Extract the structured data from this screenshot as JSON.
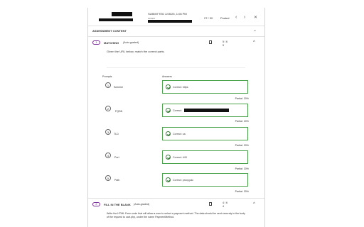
{
  "header": {
    "submitted": "SUBMITTED 2/25/25, 1:08 PM",
    "attempt_count": "27 / 30",
    "status": "Posted"
  },
  "section_title": "ASSESSMENT CONTENT",
  "q1": {
    "number": "1",
    "type": "MATCHING",
    "auto": "(Auto-graded)",
    "score_top": "5 / 6",
    "score_bottom": "5",
    "instruction": "Given the URL below, match the correct parts.",
    "prompts_header": "Prompts",
    "answers_header": "Answers",
    "items": [
      {
        "num": "1",
        "prompt": "Scheme",
        "answer": "Correct: https",
        "partial": "Partial: 20%"
      },
      {
        "num": "2",
        "prompt": "FQDN",
        "answer": "Correct:",
        "partial": "Partial: 20%"
      },
      {
        "num": "3",
        "prompt": "TLD",
        "answer": "Correct: ca",
        "partial": "Partial: 20%"
      },
      {
        "num": "4",
        "prompt": "Port",
        "answer": "Correct: 443",
        "partial": "Partial: 20%"
      },
      {
        "num": "5",
        "prompt": "Path",
        "answer": "Correct: proxy.pac",
        "partial": "Partial: 20%"
      }
    ]
  },
  "q2": {
    "number": "2",
    "type": "FILL IN THE BLANK",
    "auto": "(Auto-graded)",
    "score_top": "4 / 6",
    "score_bottom": "4",
    "text": "Write the HTML Form code that will allow a user to select a payment method. The data should be sent securely in the body of the request to cart.php, under the name PaymentMethod."
  },
  "icons": {
    "prev": "chevron-left-icon",
    "next": "chevron-right-icon",
    "close": "close-icon",
    "collapse": "chevron-up-icon",
    "expand": "chevron-down-icon",
    "doc": "document-icon"
  }
}
